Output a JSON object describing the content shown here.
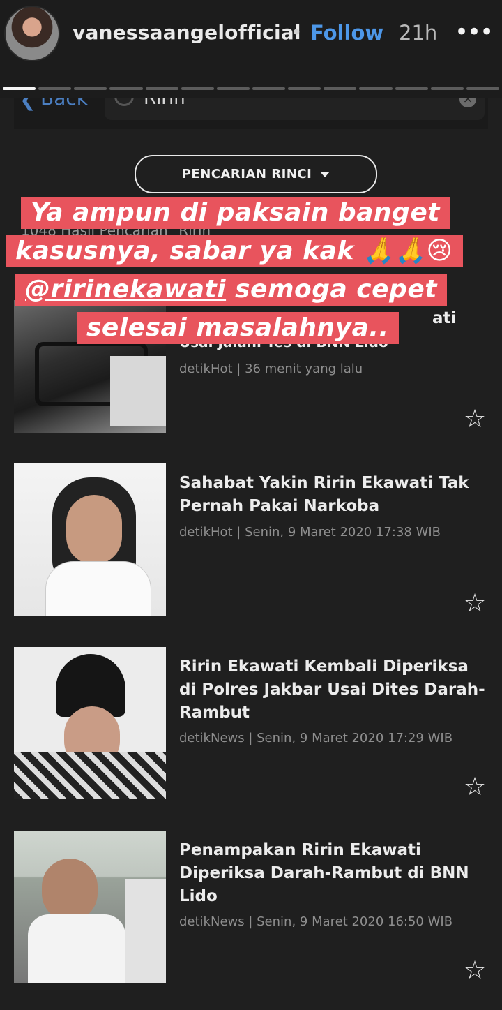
{
  "story": {
    "username": "vanessaangelofficial",
    "separator": "•",
    "follow_label": "Follow",
    "time_ago": "21h",
    "more_label": "•••",
    "progress": {
      "total_segments": 14,
      "current_index": 1
    }
  },
  "app": {
    "back_label": "Back",
    "search_value": "Ririn",
    "clear_label": "×",
    "filter_label": "PENCARIAN RINCI",
    "result_count": "1048 Hasil Pencarian \"Ririn\""
  },
  "results": [
    {
      "title_visible": "ati",
      "title_line2": "Usai Jalani Tes di BNN Lido",
      "meta": "detikHot | 36 menit yang lalu"
    },
    {
      "title": "Sahabat Yakin Ririn Ekawati Tak Pernah Pakai Narkoba",
      "meta": "detikHot | Senin, 9 Maret 2020 17:38 WIB"
    },
    {
      "title": "Ririn Ekawati Kembali Diperiksa di Polres Jakbar Usai Dites Darah-Rambut",
      "meta": "detikNews | Senin, 9 Maret 2020 17:29 WIB"
    },
    {
      "title": "Penampakan Ririn Ekawati Diperiksa Darah-Rambut di BNN Lido",
      "meta": "detikNews | Senin, 9 Maret 2020 16:50 WIB"
    }
  ],
  "star_icon": "☆",
  "overlay": {
    "line1": "Ya ampun di paksain banget",
    "line2": "kasusnya, sabar ya kak 🙏🙏😢",
    "mention": "@ririnekawati",
    "line3_rest": " semoga cepet",
    "line4": "selesai masalahnya.."
  },
  "colors": {
    "follow": "#4d97e8",
    "overlay_bg": "#e8545d",
    "back": "#4b7fc2"
  }
}
